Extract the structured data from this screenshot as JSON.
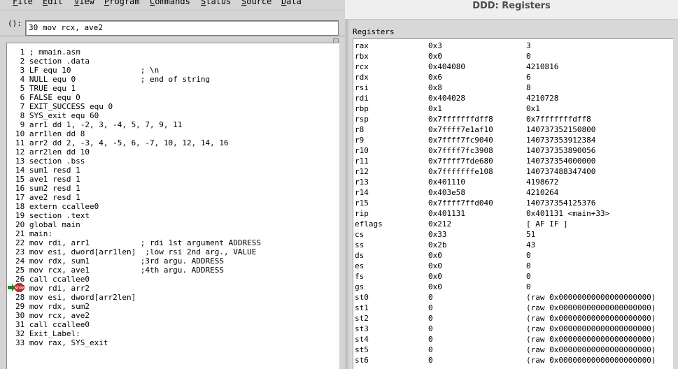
{
  "menu": [
    "File",
    "Edit",
    "View",
    "Program",
    "Commands",
    "Status",
    "Source",
    "Data"
  ],
  "argument": {
    "label": "():",
    "value": "30 mov rcx, ave2"
  },
  "source_lines": [
    " 1 ; mmain.asm",
    " 2 section .data",
    " 3 LF equ 10               ; \\n",
    " 4 NULL equ 0              ; end of string",
    " 5 TRUE equ 1",
    " 6 FALSE equ 0",
    " 7 EXIT_SUCCESS equ 0",
    " 8 SYS_exit equ 60",
    " 9 arr1 dd 1, -2, 3, -4, 5, 7, 9, 11",
    "10 arr1len dd 8",
    "11 arr2 dd 2, -3, 4, -5, 6, -7, 10, 12, 14, 16",
    "12 arr2len dd 10",
    "13 section .bss",
    "14 sum1 resd 1",
    "15 ave1 resd 1",
    "16 sum2 resd 1",
    "17 ave2 resd 1",
    "18 extern ccallee0",
    "19 section .text",
    "20 global main",
    "21 main:",
    "22 mov rdi, arr1           ; rdi 1st argument ADDRESS",
    "23 mov esi, dword[arr1len]  ;low rsi 2nd arg., VALUE",
    "24 mov rdx, sum1           ;3rd argu. ADDRESS",
    "25 mov rcx, ave1           ;4th argu. ADDRESS",
    "26 call ccallee0",
    "27 mov rdi, arr2",
    "28 mov esi, dword[arr2len]",
    "29 mov rdx, sum2",
    "30 mov rcx, ave2",
    "31 call ccallee0",
    "32 Exit_Label:",
    "33 mov rax, SYS_exit"
  ],
  "breakpoint": {
    "icon": "stop-sign-icon",
    "label": "STOP",
    "arrow_icon": "execution-arrow-icon",
    "color": "#c8282a",
    "arrow_color": "#1f8a1f"
  },
  "registers_window": {
    "title": "DDD: Registers",
    "heading": "Registers",
    "rows": [
      {
        "name": "rax",
        "hex": "0x3",
        "natural": "3"
      },
      {
        "name": "rbx",
        "hex": "0x0",
        "natural": "0"
      },
      {
        "name": "rcx",
        "hex": "0x404080",
        "natural": "4210816"
      },
      {
        "name": "rdx",
        "hex": "0x6",
        "natural": "6"
      },
      {
        "name": "rsi",
        "hex": "0x8",
        "natural": "8"
      },
      {
        "name": "rdi",
        "hex": "0x404028",
        "natural": "4210728"
      },
      {
        "name": "rbp",
        "hex": "0x1",
        "natural": "0x1"
      },
      {
        "name": "rsp",
        "hex": "0x7fffffffdff8",
        "natural": "0x7fffffffdff8"
      },
      {
        "name": "r8",
        "hex": "0x7ffff7e1af10",
        "natural": "140737352150800"
      },
      {
        "name": "r9",
        "hex": "0x7ffff7fc9040",
        "natural": "140737353912384"
      },
      {
        "name": "r10",
        "hex": "0x7ffff7fc3908",
        "natural": "140737353890056"
      },
      {
        "name": "r11",
        "hex": "0x7ffff7fde680",
        "natural": "140737354000000"
      },
      {
        "name": "r12",
        "hex": "0x7fffffffe108",
        "natural": "140737488347400"
      },
      {
        "name": "r13",
        "hex": "0x401110",
        "natural": "4198672"
      },
      {
        "name": "r14",
        "hex": "0x403e58",
        "natural": "4210264"
      },
      {
        "name": "r15",
        "hex": "0x7ffff7ffd040",
        "natural": "140737354125376"
      },
      {
        "name": "rip",
        "hex": "0x401131",
        "natural": "0x401131 <main+33>"
      },
      {
        "name": "eflags",
        "hex": "0x212",
        "natural": "[ AF IF ]"
      },
      {
        "name": "cs",
        "hex": "0x33",
        "natural": "51"
      },
      {
        "name": "ss",
        "hex": "0x2b",
        "natural": "43"
      },
      {
        "name": "ds",
        "hex": "0x0",
        "natural": "0"
      },
      {
        "name": "es",
        "hex": "0x0",
        "natural": "0"
      },
      {
        "name": "fs",
        "hex": "0x0",
        "natural": "0"
      },
      {
        "name": "gs",
        "hex": "0x0",
        "natural": "0"
      },
      {
        "name": "st0",
        "hex": "0",
        "natural": "(raw 0x00000000000000000000)"
      },
      {
        "name": "st1",
        "hex": "0",
        "natural": "(raw 0x00000000000000000000)"
      },
      {
        "name": "st2",
        "hex": "0",
        "natural": "(raw 0x00000000000000000000)"
      },
      {
        "name": "st3",
        "hex": "0",
        "natural": "(raw 0x00000000000000000000)"
      },
      {
        "name": "st4",
        "hex": "0",
        "natural": "(raw 0x00000000000000000000)"
      },
      {
        "name": "st5",
        "hex": "0",
        "natural": "(raw 0x00000000000000000000)"
      },
      {
        "name": "st6",
        "hex": "0",
        "natural": "(raw 0x00000000000000000000)"
      }
    ]
  }
}
